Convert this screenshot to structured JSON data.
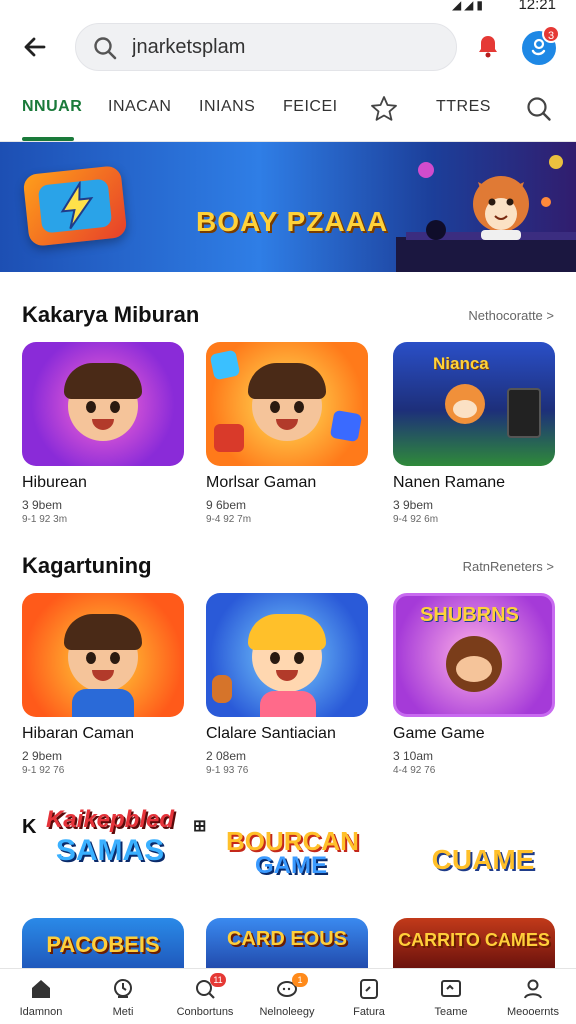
{
  "status_bar": {
    "time": "12:21"
  },
  "header": {
    "search": {
      "value": "jnarketsplam",
      "placeholder": ""
    },
    "notification_badge": "3"
  },
  "tabs": [
    {
      "label": "NNUAR",
      "active": true
    },
    {
      "label": "INACAN"
    },
    {
      "label": "INIANS"
    },
    {
      "label": "FEICEI"
    },
    {
      "label": "TTRES"
    }
  ],
  "banner": {
    "title": "BOAY PZAAA"
  },
  "sections": [
    {
      "title": "Kakarya Miburan",
      "more": "Nethocoratte >",
      "items": [
        {
          "name": "Hiburean",
          "line1": "3 9bem",
          "line2": "9-1 92 3m"
        },
        {
          "name": "Morlsar Gaman",
          "line1": "9 6bem",
          "line2": "9-4 92 7m"
        },
        {
          "name": "Nanen Ramane",
          "line1": "3 9bem",
          "line2": "9-4 92 6m"
        }
      ]
    },
    {
      "title": "Kagartuning",
      "more": "RatnReneters >",
      "items": [
        {
          "name": "Hibaran Caman",
          "line1": "2 9bem",
          "line2": "9-1 92 76"
        },
        {
          "name": "Clalare Santiacian",
          "line1": "2 08em",
          "line2": "9-1 93 76"
        },
        {
          "name": "Game Game",
          "line1": "3 10am",
          "line2": "4-4 92 76"
        }
      ]
    }
  ],
  "logos": [
    {
      "line1": "Kaikepbled",
      "line2": "SAMAS"
    },
    {
      "line1": "BOURCAN",
      "line2": "GAME"
    },
    {
      "line1": "CUAME",
      "line2": ""
    }
  ],
  "bottom_cards": [
    {
      "title": "PACOBEIS"
    },
    {
      "title": "CARD EOUS"
    },
    {
      "title": "CARRITO CAMES"
    }
  ],
  "bottom_nav": [
    {
      "label": "Idamnon"
    },
    {
      "label": "Meti"
    },
    {
      "label": "Conbortuns",
      "badge": "11"
    },
    {
      "label": "Nelnoleegy",
      "badge": "1"
    },
    {
      "label": "Fatura"
    },
    {
      "label": "Teame"
    },
    {
      "label": "Meooernts"
    }
  ],
  "colors": {
    "accent": "#1a7a3a",
    "profile": "#1e88e5",
    "badge": "#e53935"
  }
}
